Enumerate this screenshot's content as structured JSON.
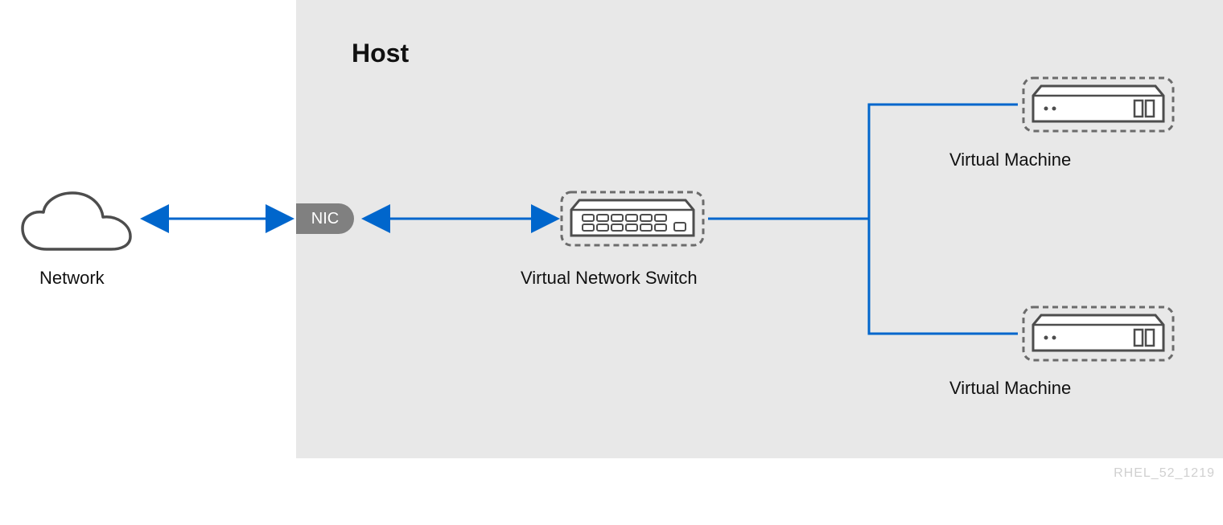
{
  "diagram": {
    "host_title": "Host",
    "network_label": "Network",
    "nic_label": "NIC",
    "vswitch_label": "Virtual Network Switch",
    "vm_label_1": "Virtual Machine",
    "vm_label_2": "Virtual Machine",
    "footer_code": "RHEL_52_1219"
  },
  "colors": {
    "line_blue": "#0066cc",
    "host_bg": "#e8e8e8",
    "stroke_gray": "#4d4d4d",
    "nic_gray": "#808080"
  },
  "nodes": [
    {
      "id": "network",
      "type": "cloud",
      "label": "Network"
    },
    {
      "id": "nic",
      "type": "interface",
      "label": "NIC"
    },
    {
      "id": "vswitch",
      "type": "switch",
      "label": "Virtual Network Switch"
    },
    {
      "id": "vm1",
      "type": "vm",
      "label": "Virtual Machine"
    },
    {
      "id": "vm2",
      "type": "vm",
      "label": "Virtual Machine"
    }
  ],
  "edges": [
    {
      "from": "network",
      "to": "nic",
      "bidirectional": true
    },
    {
      "from": "nic",
      "to": "vswitch",
      "bidirectional": true
    },
    {
      "from": "vswitch",
      "to": "vm1",
      "bidirectional": false
    },
    {
      "from": "vswitch",
      "to": "vm2",
      "bidirectional": false
    }
  ]
}
